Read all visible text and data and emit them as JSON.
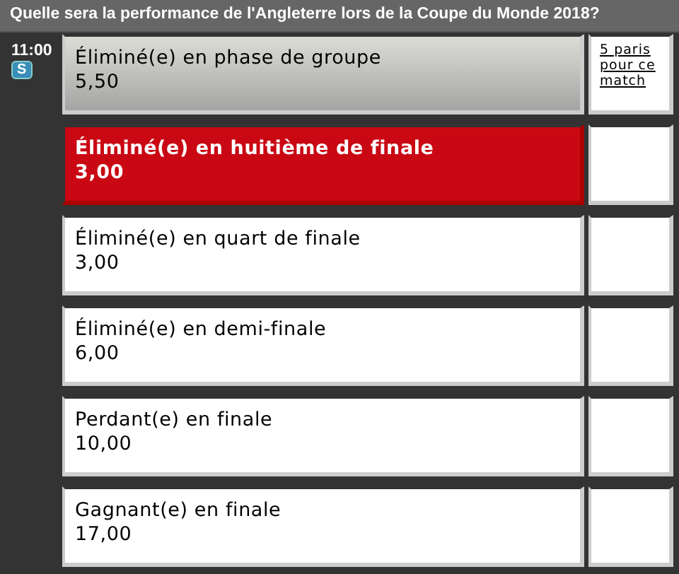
{
  "question": "Quelle sera la performance de l'Angleterre lors de la Coupe du Monde 2018?",
  "time": "11:00",
  "badge": "S",
  "options": [
    {
      "label": "Éliminé(e) en phase de groupe",
      "odds": "5,50",
      "selected": false,
      "hovered": true,
      "link": "5 paris pour ce match"
    },
    {
      "label": "Éliminé(e) en huitième de finale",
      "odds": "3,00",
      "selected": true,
      "hovered": false
    },
    {
      "label": "Éliminé(e) en quart de finale",
      "odds": "3,00",
      "selected": false,
      "hovered": false
    },
    {
      "label": "Éliminé(e) en demi-finale",
      "odds": "6,00",
      "selected": false,
      "hovered": false
    },
    {
      "label": "Perdant(e) en finale",
      "odds": "10,00",
      "selected": false,
      "hovered": false
    },
    {
      "label": "Gagnant(e) en finale",
      "odds": "17,00",
      "selected": false,
      "hovered": false
    }
  ]
}
